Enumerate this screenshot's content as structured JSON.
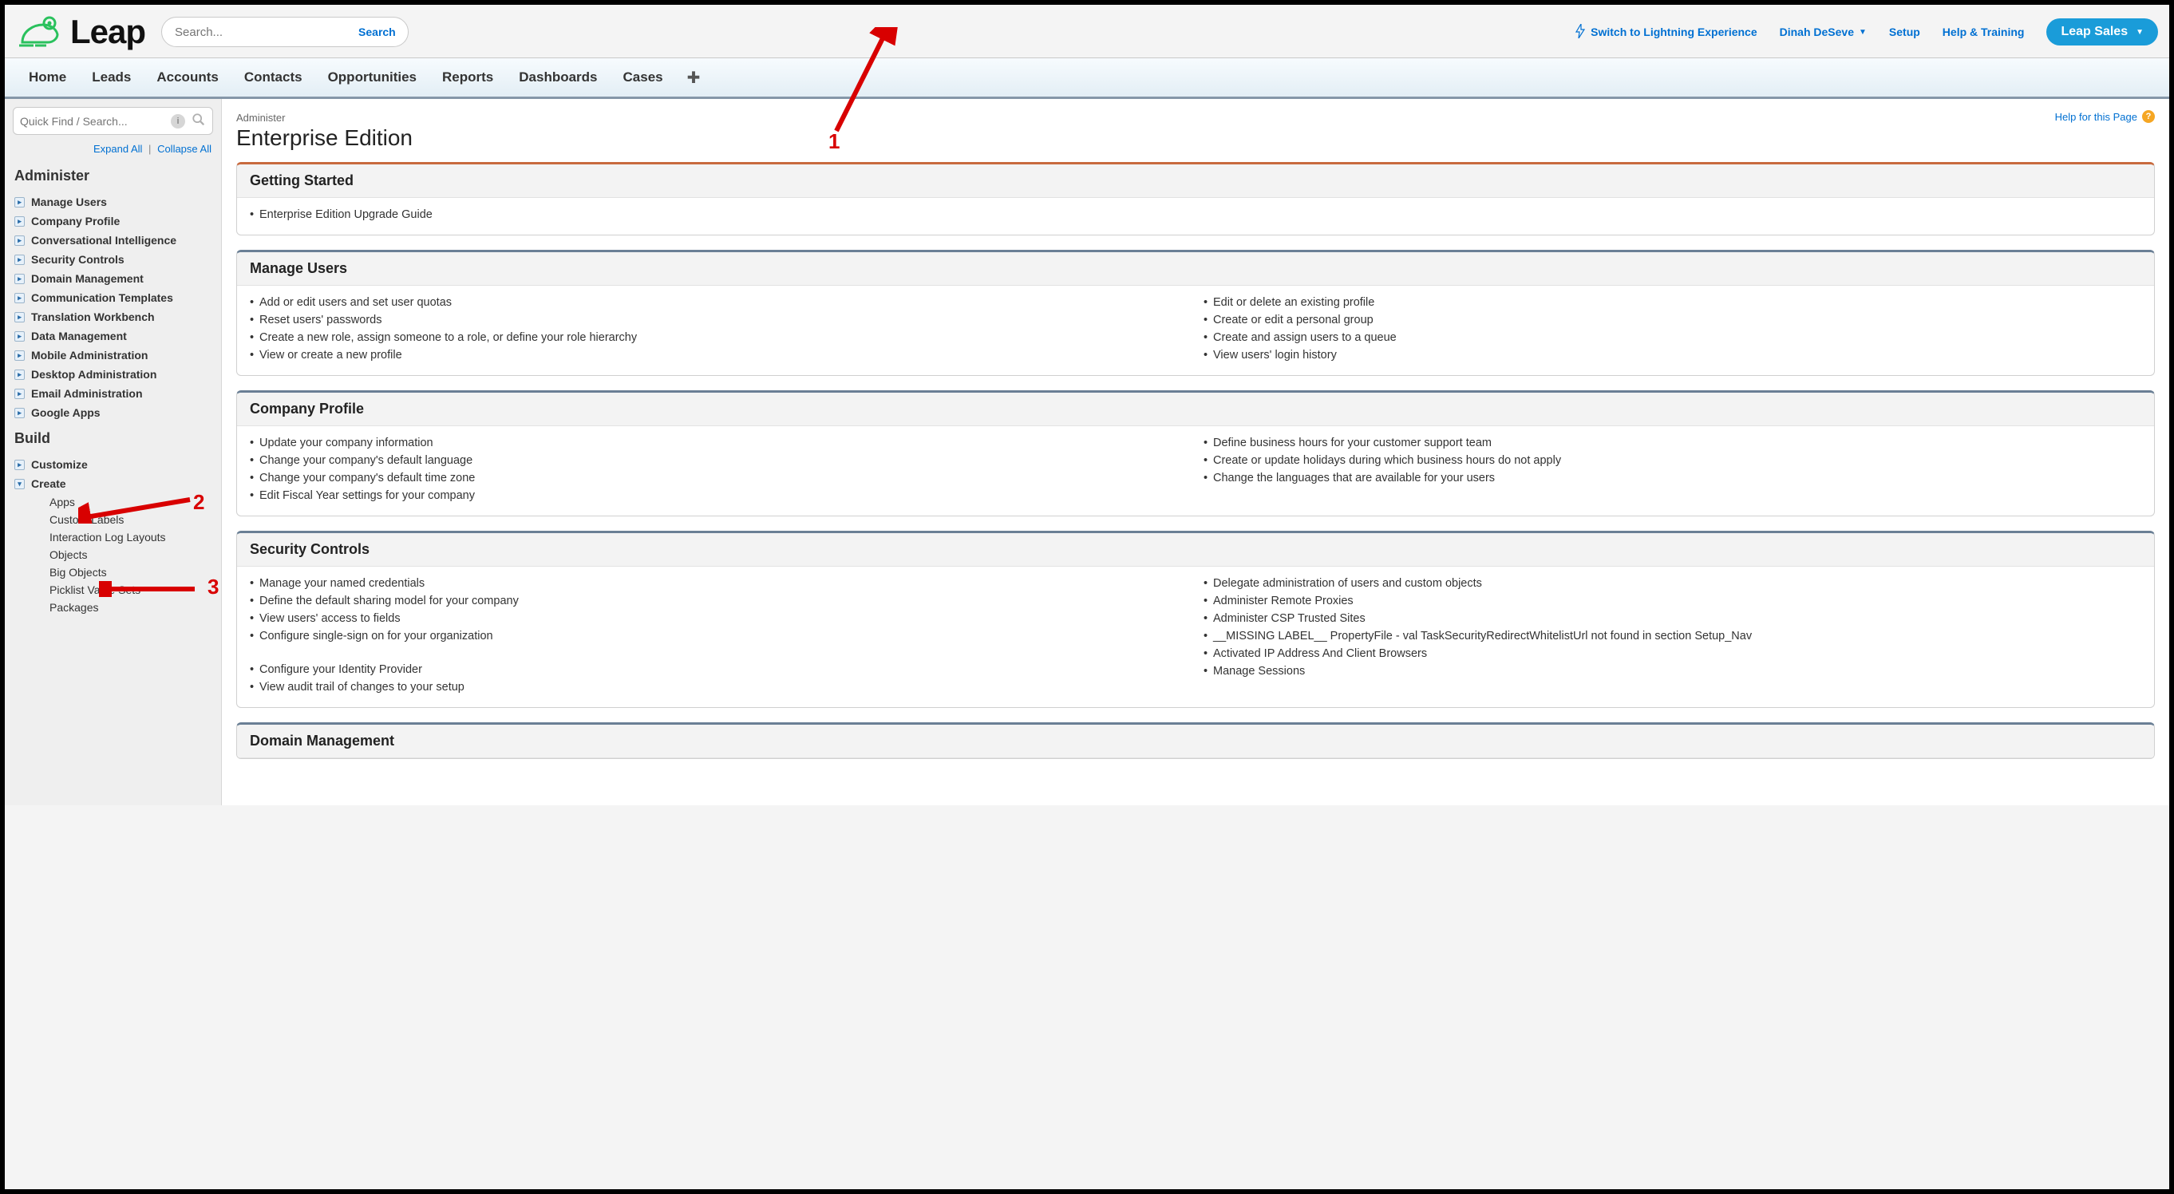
{
  "logo_text": "Leap",
  "search_placeholder": "Search...",
  "search_button": "Search",
  "top_links": {
    "lightning": "Switch to Lightning Experience",
    "user": "Dinah DeSeve",
    "setup": "Setup",
    "help": "Help & Training"
  },
  "app_pill": "Leap Sales",
  "tabs": [
    "Home",
    "Leads",
    "Accounts",
    "Contacts",
    "Opportunities",
    "Reports",
    "Dashboards",
    "Cases"
  ],
  "sidebar": {
    "quick_find_placeholder": "Quick Find / Search...",
    "expand_all": "Expand All",
    "collapse_all": "Collapse All",
    "administer_title": "Administer",
    "administer_items": [
      "Manage Users",
      "Company Profile",
      "Conversational Intelligence",
      "Security Controls",
      "Domain Management",
      "Communication Templates",
      "Translation Workbench",
      "Data Management",
      "Mobile Administration",
      "Desktop Administration",
      "Email Administration",
      "Google Apps"
    ],
    "build_title": "Build",
    "build_items": {
      "customize": "Customize",
      "create": "Create",
      "create_children": [
        "Apps",
        "Custom Labels",
        "Interaction Log Layouts",
        "Objects",
        "Big Objects",
        "Picklist Value Sets",
        "Packages"
      ]
    }
  },
  "breadcrumb": "Administer",
  "page_title": "Enterprise Edition",
  "help_for_page": "Help for this Page",
  "cards": {
    "getting_started": {
      "title": "Getting Started",
      "items": [
        "Enterprise Edition Upgrade Guide"
      ]
    },
    "manage_users": {
      "title": "Manage Users",
      "left": [
        "Add or edit users and set user quotas",
        "Reset users' passwords",
        "Create a new role, assign someone to a role, or define your role hierarchy",
        "View or create a new profile"
      ],
      "right": [
        "Edit or delete an existing profile",
        "Create or edit a personal group",
        "Create and assign users to a queue",
        "View users' login history"
      ]
    },
    "company_profile": {
      "title": "Company Profile",
      "left": [
        "Update your company information",
        "Change your company's default language",
        "Change your company's default time zone",
        "Edit Fiscal Year settings for your company"
      ],
      "right": [
        "Define business hours for your customer support team",
        "Create or update holidays during which business hours do not apply",
        "Change the languages that are available for your users"
      ]
    },
    "security_controls": {
      "title": "Security Controls",
      "left": [
        "Manage your named credentials",
        "Define the default sharing model for your company",
        "View users' access to fields",
        "Configure single-sign on for your organization",
        "",
        "Configure your Identity Provider",
        "View audit trail of changes to your setup"
      ],
      "right": [
        "Delegate administration of users and custom objects",
        "Administer Remote Proxies",
        "Administer CSP Trusted Sites",
        "__MISSING LABEL__ PropertyFile - val TaskSecurityRedirectWhitelistUrl not found in section Setup_Nav",
        "Activated IP Address And Client Browsers",
        "Manage Sessions"
      ]
    },
    "domain_management": {
      "title": "Domain Management"
    }
  },
  "annotations": {
    "n1": "1",
    "n2": "2",
    "n3": "3"
  }
}
